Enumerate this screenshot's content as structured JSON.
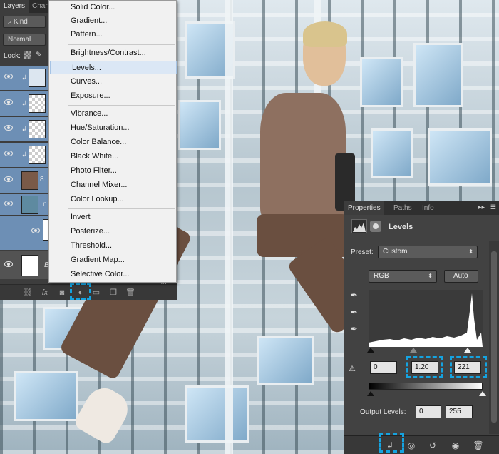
{
  "layers_panel": {
    "tabs": [
      "Layers",
      "Chann"
    ],
    "filter_kind": "Kind",
    "blend_mode": "Normal",
    "lock_label": "Lock:",
    "fx_label": "fx",
    "row_fragments": {
      "chain": "8",
      "mask_letter": "n",
      "bg_letter": "B"
    }
  },
  "adjustment_menu": {
    "items": [
      "Solid Color...",
      "Gradient...",
      "Pattern...",
      "Brightness/Contrast...",
      "Levels...",
      "Curves...",
      "Exposure...",
      "Vibrance...",
      "Hue/Saturation...",
      "Color Balance...",
      "Black  White...",
      "Photo Filter...",
      "Channel Mixer...",
      "Color Lookup...",
      "Invert",
      "Posterize...",
      "Threshold...",
      "Gradient Map...",
      "Selective Color..."
    ],
    "highlighted": "Levels..."
  },
  "properties_panel": {
    "tabs": [
      "Properties",
      "Paths",
      "Info"
    ],
    "title": "Levels",
    "preset_label": "Preset:",
    "preset_value": "Custom",
    "channel": "RGB",
    "auto_label": "Auto",
    "input_black": "0",
    "input_gamma": "1.20",
    "input_white": "221",
    "output_label": "Output Levels:",
    "output_black": "0",
    "output_white": "255"
  },
  "accent_color": "#15a3e0"
}
